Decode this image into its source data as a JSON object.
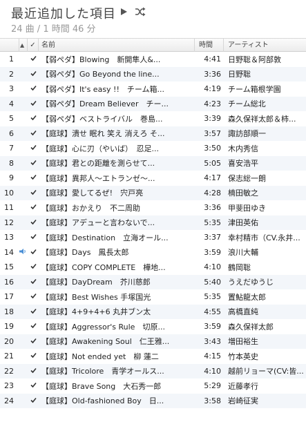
{
  "header": {
    "title": "最近追加した項目",
    "subtitle": "24 曲 / 1 時間 46 分",
    "play_icon": "play-icon",
    "shuffle_icon": "shuffle-icon"
  },
  "columns": {
    "num": "",
    "sort": "▲",
    "check": "✓",
    "name": "名前",
    "time": "時間",
    "artist": "アーティスト"
  },
  "tracks": [
    {
      "num": "1",
      "name": "【弱ペダ】Blowing　新開隼人&...",
      "time": "4:41",
      "artist": "日野聡＆阿部敦"
    },
    {
      "num": "2",
      "name": "【弱ペダ】Go Beyond the line...",
      "time": "3:36",
      "artist": "日野聡"
    },
    {
      "num": "3",
      "name": "【弱ペダ】It's easy !!　チーム箱...",
      "time": "4:19",
      "artist": "チーム箱根学園"
    },
    {
      "num": "4",
      "name": "【弱ペダ】Dream Believer　チー...",
      "time": "4:23",
      "artist": "チーム総北"
    },
    {
      "num": "5",
      "name": "【弱ペダ】ベストライバル　巻島...",
      "time": "3:39",
      "artist": "森久保祥太郎＆柿..."
    },
    {
      "num": "6",
      "name": "【庭球】潰せ 眠れ 笑え 消えろ そ...",
      "time": "3:57",
      "artist": "諏訪部順一"
    },
    {
      "num": "7",
      "name": "【庭球】心に刃（やいば）　忍足...",
      "time": "3:50",
      "artist": "木内秀信"
    },
    {
      "num": "8",
      "name": "【庭球】君との距離を測らせて...",
      "time": "5:05",
      "artist": "喜安浩平"
    },
    {
      "num": "9",
      "name": "【庭球】異邦人～エトランゼ～...",
      "time": "4:17",
      "artist": "保志総一朗"
    },
    {
      "num": "10",
      "name": "【庭球】愛してるぜ!　宍戸亮",
      "time": "4:28",
      "artist": "楠田敏之"
    },
    {
      "num": "11",
      "name": "【庭球】おかえり　不二周助",
      "time": "3:36",
      "artist": "甲斐田ゆき"
    },
    {
      "num": "12",
      "name": "【庭球】アデューと言わないで...",
      "time": "5:35",
      "artist": "津田英佑"
    },
    {
      "num": "13",
      "name": "【庭球】Destination　立海オール...",
      "time": "3:37",
      "artist": "幸村精市（CV.永井..."
    },
    {
      "num": "14",
      "name": "【庭球】Days　鳳長太郎",
      "time": "3:59",
      "artist": "浪川大輔"
    },
    {
      "num": "15",
      "name": "【庭球】COPY COMPLETE　樺地...",
      "time": "4:10",
      "artist": "鶴岡聡"
    },
    {
      "num": "16",
      "name": "【庭球】DayDream　芥川慈郎",
      "time": "5:40",
      "artist": "うえだゆうじ"
    },
    {
      "num": "17",
      "name": "【庭球】Best Wishes 手塚国光",
      "time": "5:35",
      "artist": "置鮎龍太郎"
    },
    {
      "num": "18",
      "name": "【庭球】4+9+4+6 丸井ブン太",
      "time": "4:55",
      "artist": "高橋直純"
    },
    {
      "num": "19",
      "name": "【庭球】Aggressor's Rule　切原...",
      "time": "3:59",
      "artist": "森久保祥太郎"
    },
    {
      "num": "20",
      "name": "【庭球】Awakening Soul　仁王雅...",
      "time": "3:43",
      "artist": "増田裕生"
    },
    {
      "num": "21",
      "name": "【庭球】Not ended yet　柳 蓮二",
      "time": "4:15",
      "artist": "竹本英史"
    },
    {
      "num": "22",
      "name": "【庭球】Tricolore　青学オールス...",
      "time": "4:10",
      "artist": "越前リョーマ(CV:皆..."
    },
    {
      "num": "23",
      "name": "【庭球】Brave Song　大石秀一郎",
      "time": "5:29",
      "artist": "近藤孝行"
    },
    {
      "num": "24",
      "name": "【庭球】Old-fashioned Boy　日...",
      "time": "3:58",
      "artist": "岩崎征実"
    }
  ],
  "playing_index": 13,
  "colors": {
    "alt_row": "#f3f6fa",
    "speaker": "#4a8fd6"
  }
}
